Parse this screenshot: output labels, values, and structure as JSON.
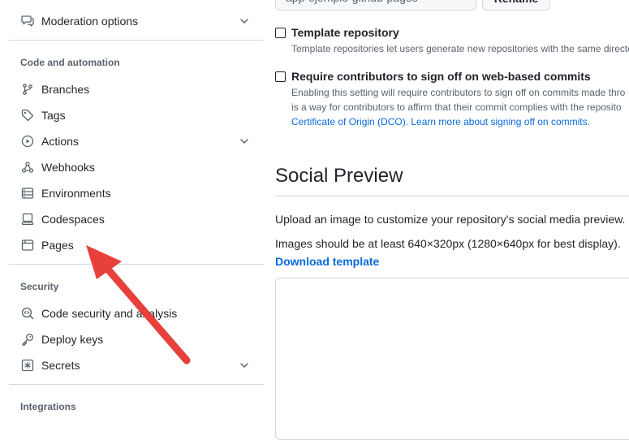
{
  "sidebar": {
    "top_item": {
      "label": "Moderation options",
      "icon": "comment-discussion-icon"
    },
    "section_code": {
      "heading": "Code and automation",
      "items": [
        {
          "label": "Branches",
          "icon": "git-branch-icon"
        },
        {
          "label": "Tags",
          "icon": "tag-icon"
        },
        {
          "label": "Actions",
          "icon": "play-icon"
        },
        {
          "label": "Webhooks",
          "icon": "webhook-icon"
        },
        {
          "label": "Environments",
          "icon": "server-icon"
        },
        {
          "label": "Codespaces",
          "icon": "codespaces-icon"
        },
        {
          "label": "Pages",
          "icon": "browser-icon"
        }
      ]
    },
    "section_security": {
      "heading": "Security",
      "items": [
        {
          "label": "Code security and analysis",
          "icon": "codescan-icon"
        },
        {
          "label": "Deploy keys",
          "icon": "key-icon"
        },
        {
          "label": "Secrets",
          "icon": "key-asterisk-icon"
        }
      ]
    },
    "section_integrations": {
      "heading": "Integrations"
    }
  },
  "main": {
    "repo_name_value": "app-ejemplo-github-pages",
    "rename_label": "Rename",
    "template": {
      "title": "Template repository",
      "desc": "Template repositories let users generate new repositories with the same directo"
    },
    "signoff": {
      "title": "Require contributors to sign off on web-based commits",
      "desc_line1": "Enabling this setting will require contributors to sign off on commits made thro",
      "desc_line2": "is a way for contributors to affirm that their commit complies with the reposito",
      "link_dco": "Certificate of Origin (DCO).",
      "link_learn": "Learn more about signing off on commits."
    },
    "social_preview": {
      "title": "Social Preview",
      "upload_text": "Upload an image to customize your repository's social media preview.",
      "size_text": "Images should be at least 640×320px (1280×640px for best display).",
      "download_label": "Download template"
    }
  },
  "colors": {
    "link": "#0969da",
    "text": "#1f2328",
    "muted": "#59636e",
    "border": "#d1d9e0",
    "annotation_arrow": "#e8413c"
  }
}
